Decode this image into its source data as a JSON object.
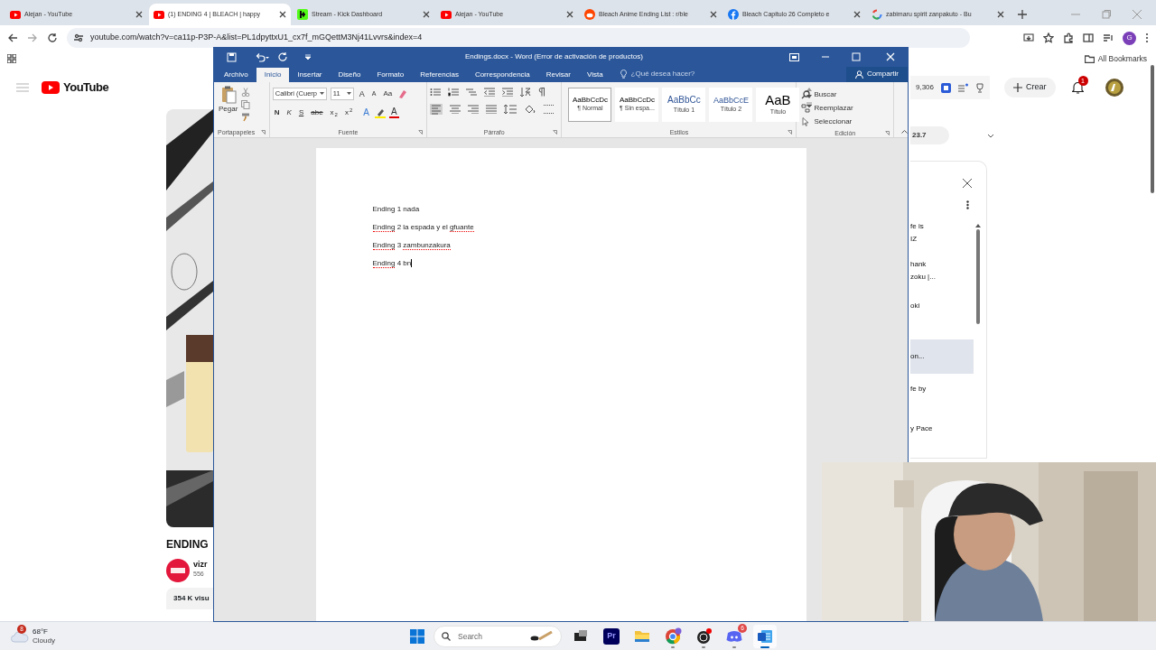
{
  "browser": {
    "tabs": [
      {
        "title": "Alejan - YouTube",
        "kind": "youtube",
        "selected": false
      },
      {
        "title": "(1) ENDING 4 | BLEACH | happy",
        "kind": "youtube",
        "selected": true
      },
      {
        "title": "Stream - Kick Dashboard",
        "kind": "kick",
        "selected": false
      },
      {
        "title": "Alejan - YouTube",
        "kind": "youtube",
        "selected": false
      },
      {
        "title": "Bleach Anime Ending List : r/ble",
        "kind": "reddit",
        "selected": false
      },
      {
        "title": "Bleach Capitulo 26 Completo e",
        "kind": "facebook",
        "selected": false
      },
      {
        "title": "zabimaru spirit zanpakuto - Bu",
        "kind": "google",
        "selected": false
      }
    ],
    "url": "youtube.com/watch?v=ca11p-P3P-A&list=PL1dpyttxU1_cx7f_mGQettM3Nj41Lvvrs&index=4",
    "profile_initial": "G",
    "bookmarks_label": "All Bookmarks"
  },
  "youtube": {
    "logo_text": "YouTube",
    "video_title": "ENDING",
    "channel": "vizr",
    "channel_subs": "556",
    "views": "354 K visu",
    "like_count": "9,306",
    "create_label": "Crear",
    "notification_count": "1",
    "speed": "23.7",
    "playlist": [
      {
        "lines": [
          "fe is",
          "IZ"
        ],
        "selected": false
      },
      {
        "lines": [
          "hank",
          "zoku |..."
        ],
        "selected": false
      },
      {
        "lines": [
          "oki"
        ],
        "selected": false
      },
      {
        "lines": [
          "on..."
        ],
        "selected": true
      },
      {
        "lines": [
          "fe by"
        ],
        "selected": false
      },
      {
        "lines": [
          "y Pace"
        ],
        "selected": false
      }
    ]
  },
  "word": {
    "title": "Endings.docx - Word (Error de activación de productos)",
    "tabs": [
      {
        "label": "Archivo",
        "selected": false
      },
      {
        "label": "Inicio",
        "selected": true
      },
      {
        "label": "Insertar",
        "selected": false
      },
      {
        "label": "Diseño",
        "selected": false
      },
      {
        "label": "Formato",
        "selected": false
      },
      {
        "label": "Referencias",
        "selected": false
      },
      {
        "label": "Correspondencia",
        "selected": false
      },
      {
        "label": "Revisar",
        "selected": false
      },
      {
        "label": "Vista",
        "selected": false
      }
    ],
    "tell_me": "¿Qué desea hacer?",
    "share": "Compartir",
    "paste": "Pegar",
    "font": "Calibri (Cuerp",
    "font_size": "11",
    "grow": "A",
    "shrink": "A",
    "change_case": "Aa",
    "format_buttons": [
      "N",
      "K",
      "S",
      "abe",
      "x$_{2}$",
      "x$^{2}$"
    ],
    "text_effect": "A",
    "font_color": "A",
    "groups": [
      "Portapapeles",
      "Fuente",
      "Párrafo",
      "Estilos",
      "Edición"
    ],
    "styles": [
      {
        "preview": "AaBbCcDc",
        "name": "¶ Normal",
        "selected": true
      },
      {
        "preview": "AaBbCcDc",
        "name": "¶ Sin espa...",
        "selected": false
      },
      {
        "preview": "AaBbCc",
        "name": "Título 1",
        "selected": false
      },
      {
        "preview": "AaBbCcE",
        "name": "Título 2",
        "selected": false
      },
      {
        "preview": "AaB",
        "name": "Título",
        "selected": false
      }
    ],
    "editing": [
      "Buscar",
      "Reemplazar",
      "Seleccionar"
    ],
    "document": [
      {
        "segments": [
          {
            "text": "Ending 1 nada",
            "misspelled": false
          }
        ]
      },
      {
        "segments": [
          {
            "text": "Ending",
            "misspelled": true
          },
          {
            "text": " 2 la espada y el ",
            "misspelled": false
          },
          {
            "text": "gfuante",
            "misspelled": true
          }
        ]
      },
      {
        "segments": [
          {
            "text": "Ending",
            "misspelled": true
          },
          {
            "text": " 3 ",
            "misspelled": false
          },
          {
            "text": "zambunzakura",
            "misspelled": true
          }
        ]
      },
      {
        "segments": [
          {
            "text": "Ending",
            "misspelled": true
          },
          {
            "text": " 4 bn",
            "misspelled": false
          }
        ],
        "cursor": true
      }
    ]
  },
  "taskbar": {
    "weather": {
      "badge": "8",
      "temperature": "68°F",
      "condition": "Cloudy"
    },
    "search_placeholder": "Search",
    "apps": [
      {
        "kind": "taskview",
        "running": false,
        "selected": false
      },
      {
        "kind": "premiere",
        "label": "Pr",
        "running": false,
        "selected": false
      },
      {
        "kind": "folder",
        "running": false,
        "selected": false
      },
      {
        "kind": "chrome",
        "running": true,
        "selected": false
      },
      {
        "kind": "obs",
        "running": true,
        "selected": false
      },
      {
        "kind": "discord",
        "badge": "6",
        "running": true,
        "selected": false
      },
      {
        "kind": "word",
        "running": true,
        "selected": true
      }
    ]
  }
}
